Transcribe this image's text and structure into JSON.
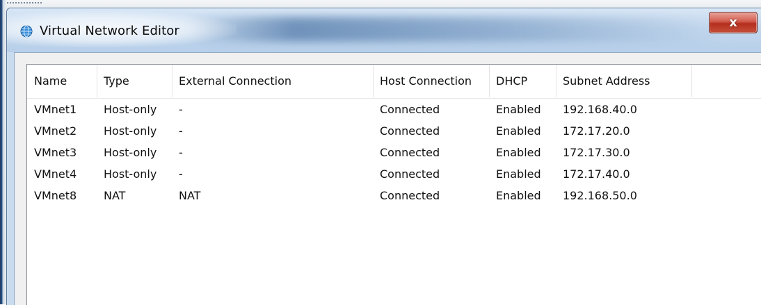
{
  "window": {
    "title": "Virtual Network Editor",
    "close_label": "x",
    "icon": "globe-icon"
  },
  "table": {
    "columns": [
      "Name",
      "Type",
      "External Connection",
      "Host Connection",
      "DHCP",
      "Subnet Address"
    ],
    "rows": [
      [
        "VMnet1",
        "Host-only",
        "-",
        "Connected",
        "Enabled",
        "192.168.40.0"
      ],
      [
        "VMnet2",
        "Host-only",
        "-",
        "Connected",
        "Enabled",
        "172.17.20.0"
      ],
      [
        "VMnet3",
        "Host-only",
        "-",
        "Connected",
        "Enabled",
        "172.17.30.0"
      ],
      [
        "VMnet4",
        "Host-only",
        "-",
        "Connected",
        "Enabled",
        "172.17.40.0"
      ],
      [
        "VMnet8",
        "NAT",
        "NAT",
        "Connected",
        "Enabled",
        "192.168.50.0"
      ]
    ]
  }
}
